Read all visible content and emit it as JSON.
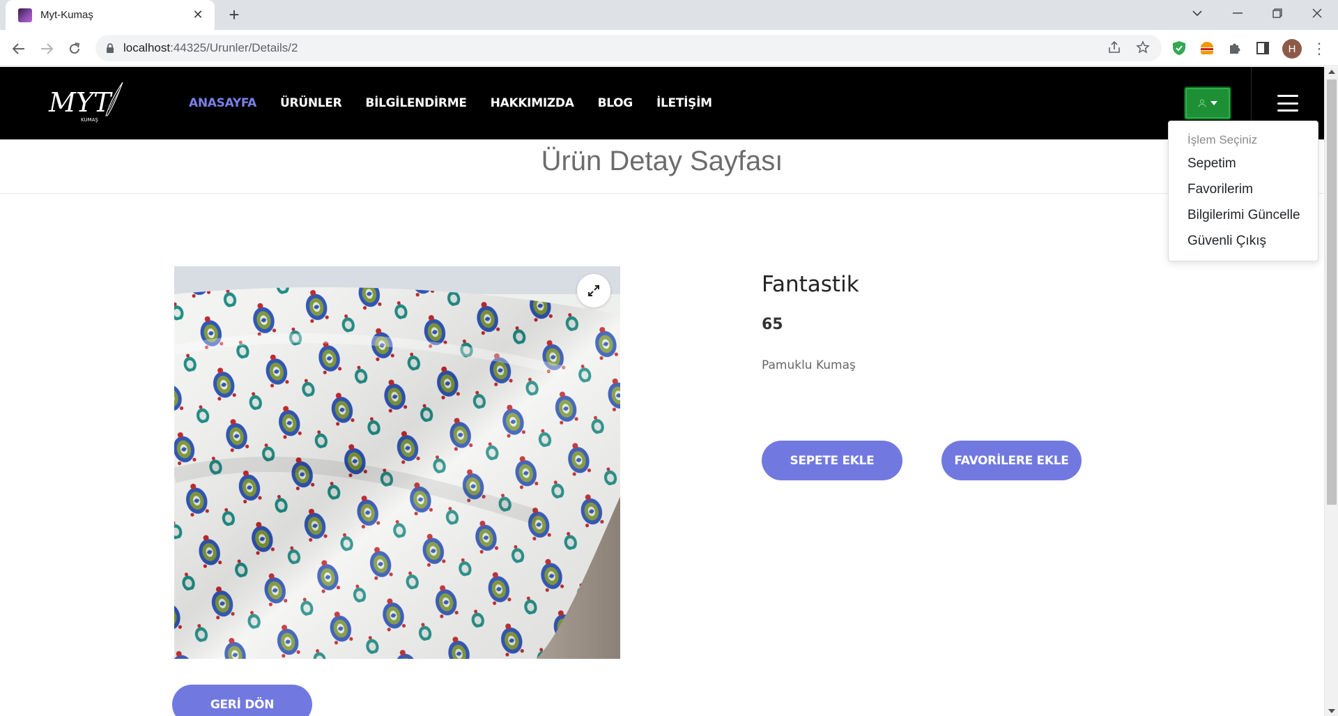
{
  "browser": {
    "tab_title": "Myt-Kumaş",
    "url_host": "localhost",
    "url_rest": ":44325/Urunler/Details/2",
    "avatar_letter": "H"
  },
  "header": {
    "logo_text": "MYT",
    "logo_sub": "KUMAŞ",
    "nav": [
      {
        "label": "ANASAYFA",
        "active": true
      },
      {
        "label": "ÜRÜNLER"
      },
      {
        "label": "BİLGİLENDİRME"
      },
      {
        "label": "HAKKIMIZDA"
      },
      {
        "label": "BLOG"
      },
      {
        "label": "İLETİŞİM"
      }
    ],
    "user_button_color": "#1f8f36",
    "accent_color": "#7b7fe6"
  },
  "dropdown": {
    "header": "İşlem Seçiniz",
    "items": [
      "Sepetim",
      "Favorilerim",
      "Bilgilerimi Güncelle",
      "Güvenli Çıkış"
    ]
  },
  "page": {
    "title": "Ürün Detay Sayfası"
  },
  "product": {
    "name": "Fantastik",
    "price": "65",
    "description": "Pamuklu Kumaş",
    "add_to_cart": "SEPETE EKLE",
    "add_to_favorites": "FAVORİLERE EKLE",
    "back": "GERİ DÖN",
    "button_color": "#7179e0"
  }
}
